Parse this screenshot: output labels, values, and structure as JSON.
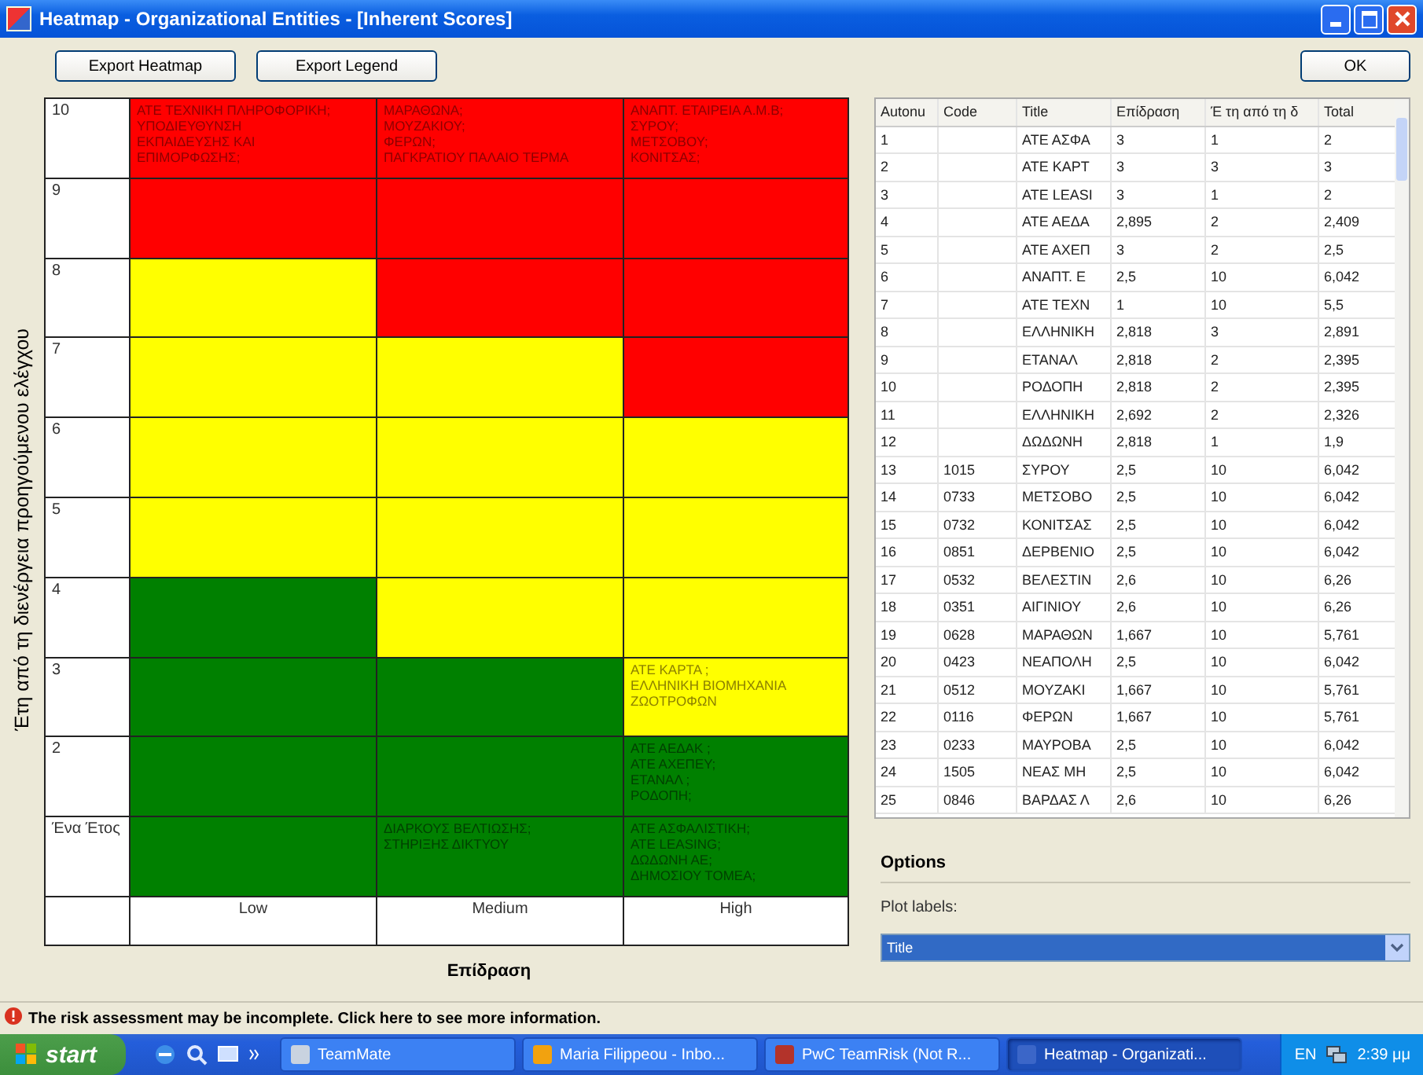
{
  "window": {
    "title": "Heatmap - Organizational Entities - [Inherent Scores]"
  },
  "toolbar": {
    "buttons": [
      "Export Heatmap",
      "Export Legend"
    ],
    "ok_button": "OK"
  },
  "heatmap": {
    "y_axis_title": "Έτη από τη διενέργεια προηγούμενου ελέγχου",
    "x_axis_title": "Επίδραση",
    "rows": [
      {
        "label": "10",
        "cells": [
          {
            "color": "#ff0000",
            "text": "ΑΤΕ ΤΕΧΝΙΚΗ ΠΛΗΡΟΦΟΡΙΚΗ;\nΥΠΟΔΙΕΥΘΥΝΣΗ\nΕΚΠΑΙΔΕΥΣΗΣ ΚΑΙ\nΕΠΙΜΟΡΦΩΣΗΣ;"
          },
          {
            "color": "#ff0000",
            "text": "ΜΑΡΑΘΩΝΑ;\nΜΟΥΖΑΚΙΟΥ;\nΦΕΡΩΝ;\nΠΑΓΚΡΑΤΙΟΥ ΠΑΛΑΙΟ ΤΕΡΜΑ"
          },
          {
            "color": "#ff0000",
            "text": "ΑΝΑΠΤ. ΕΤΑΙΡΕΙΑ Α.Μ.Β;\nΣΥΡΟΥ;\nΜΕΤΣΟΒΟΥ;\nΚΟΝΙΤΣΑΣ;"
          }
        ]
      },
      {
        "label": "9",
        "cells": [
          {
            "color": "#ff0000"
          },
          {
            "color": "#ff0000"
          },
          {
            "color": "#ff0000"
          }
        ]
      },
      {
        "label": "8",
        "cells": [
          {
            "color": "#ffff00"
          },
          {
            "color": "#ff0000"
          },
          {
            "color": "#ff0000"
          }
        ]
      },
      {
        "label": "7",
        "cells": [
          {
            "color": "#ffff00"
          },
          {
            "color": "#ffff00"
          },
          {
            "color": "#ff0000"
          }
        ]
      },
      {
        "label": "6",
        "cells": [
          {
            "color": "#ffff00"
          },
          {
            "color": "#ffff00"
          },
          {
            "color": "#ffff00"
          }
        ]
      },
      {
        "label": "5",
        "cells": [
          {
            "color": "#ffff00"
          },
          {
            "color": "#ffff00"
          },
          {
            "color": "#ffff00"
          }
        ]
      },
      {
        "label": "4",
        "cells": [
          {
            "color": "#008000"
          },
          {
            "color": "#ffff00"
          },
          {
            "color": "#ffff00"
          }
        ]
      },
      {
        "label": "3",
        "cells": [
          {
            "color": "#008000"
          },
          {
            "color": "#008000"
          },
          {
            "color": "#ffff00",
            "text": "ΑΤΕ ΚΑΡΤΑ ;\nΕΛΛΗΝΙΚΗ ΒΙΟΜΗΧΑΝΙΑ\nΖΩΟΤΡΟΦΩΝ"
          }
        ]
      },
      {
        "label": "2",
        "cells": [
          {
            "color": "#008000"
          },
          {
            "color": "#008000"
          },
          {
            "color": "#008000",
            "text": "ΑΤΕ ΑΕΔΑΚ ;\nΑΤΕ ΑΧΕΠΕΥ;\nΕΤΑΝΑΛ ;\nΡΟΔΟΠΗ;"
          }
        ]
      },
      {
        "label": "Ένα Έτος",
        "cells": [
          {
            "color": "#008000"
          },
          {
            "color": "#008000",
            "text": "ΔΙΑΡΚΟΥΣ ΒΕΛΤΙΩΣΗΣ;\nΣΤΗΡΙΞΗΣ ΔΙΚΤΥΟΥ"
          },
          {
            "color": "#008000",
            "text": "ΑΤΕ ΑΣΦΑΛΙΣΤΙΚΗ;\nΑΤΕ LEASING;\nΔΩΔΩΝΗ ΑΕ;\nΔΗΜΟΣΙΟΥ ΤΟΜΕΑ;"
          }
        ]
      }
    ],
    "bottom_labels": [
      "Low",
      "Medium",
      "High"
    ]
  },
  "table": {
    "columns": [
      "Autonu",
      "Code",
      "Title",
      "Επίδραση",
      "Έ τη από τη δ",
      "Total"
    ],
    "rows": [
      [
        "1",
        "",
        "ΑΤΕ ΑΣΦΑ",
        "3",
        "1",
        "2"
      ],
      [
        "2",
        "",
        "ΑΤΕ ΚΑΡΤ",
        "3",
        "3",
        "3"
      ],
      [
        "3",
        "",
        "ΑΤΕ LEASI",
        "3",
        "1",
        "2"
      ],
      [
        "4",
        "",
        "ΑΤΕ ΑΕΔΑ",
        "2,895",
        "2",
        "2,409"
      ],
      [
        "5",
        "",
        "ΑΤΕ ΑΧΕΠ",
        "3",
        "2",
        "2,5"
      ],
      [
        "6",
        "",
        "ΑΝΑΠΤ. Ε",
        "2,5",
        "10",
        "6,042"
      ],
      [
        "7",
        "",
        "ΑΤΕ ΤΕΧΝ",
        "1",
        "10",
        "5,5"
      ],
      [
        "8",
        "",
        "ΕΛΛΗΝΙΚΗ",
        "2,818",
        "3",
        "2,891"
      ],
      [
        "9",
        "",
        "ΕΤΑΝΑΛ",
        "2,818",
        "2",
        "2,395"
      ],
      [
        "10",
        "",
        "ΡΟΔΟΠΗ",
        "2,818",
        "2",
        "2,395"
      ],
      [
        "11",
        "",
        "ΕΛΛΗΝΙΚΗ",
        "2,692",
        "2",
        "2,326"
      ],
      [
        "12",
        "",
        "ΔΩΔΩΝΗ",
        "2,818",
        "1",
        "1,9"
      ],
      [
        "13",
        "1015",
        "ΣΥΡΟΥ",
        "2,5",
        "10",
        "6,042"
      ],
      [
        "14",
        "0733",
        "ΜΕΤΣΟΒΟ",
        "2,5",
        "10",
        "6,042"
      ],
      [
        "15",
        "0732",
        "ΚΟΝΙΤΣΑΣ",
        "2,5",
        "10",
        "6,042"
      ],
      [
        "16",
        "0851",
        "ΔΕΡΒΕΝΙΟ",
        "2,5",
        "10",
        "6,042"
      ],
      [
        "17",
        "0532",
        "ΒΕΛΕΣΤΙΝ",
        "2,6",
        "10",
        "6,26"
      ],
      [
        "18",
        "0351",
        "ΑΙΓΙΝΙΟΥ",
        "2,6",
        "10",
        "6,26"
      ],
      [
        "19",
        "0628",
        "ΜΑΡΑΘΩΝ",
        "1,667",
        "10",
        "5,761"
      ],
      [
        "20",
        "0423",
        "ΝΕΑΠΟΛΗ",
        "2,5",
        "10",
        "6,042"
      ],
      [
        "21",
        "0512",
        "ΜΟΥΖΑΚΙ",
        "1,667",
        "10",
        "5,761"
      ],
      [
        "22",
        "0116",
        "ΦΕΡΩΝ",
        "1,667",
        "10",
        "5,761"
      ],
      [
        "23",
        "0233",
        "ΜΑΥΡΟΒΑ",
        "2,5",
        "10",
        "6,042"
      ],
      [
        "24",
        "1505",
        "ΝΕΑΣ ΜΗ",
        "2,5",
        "10",
        "6,042"
      ],
      [
        "25",
        "0846",
        "ΒΑΡΔΑΣ Λ",
        "2,6",
        "10",
        "6,26"
      ]
    ]
  },
  "options": {
    "heading": "Options",
    "plot_labels_label": "Plot labels:",
    "plot_labels_value": "Title"
  },
  "status_bar": {
    "message": "The risk assessment may be incomplete. Click here to see more information."
  },
  "taskbar": {
    "start": "start",
    "tasks": [
      {
        "label": "TeamMate",
        "selected": false
      },
      {
        "label": "Maria Filippeou - Inbo...",
        "selected": false
      },
      {
        "label": "PwC TeamRisk (Not R...",
        "selected": false
      },
      {
        "label": "Heatmap - Organizati...",
        "selected": true
      }
    ],
    "language": "EN",
    "time": "2:39 μμ"
  }
}
